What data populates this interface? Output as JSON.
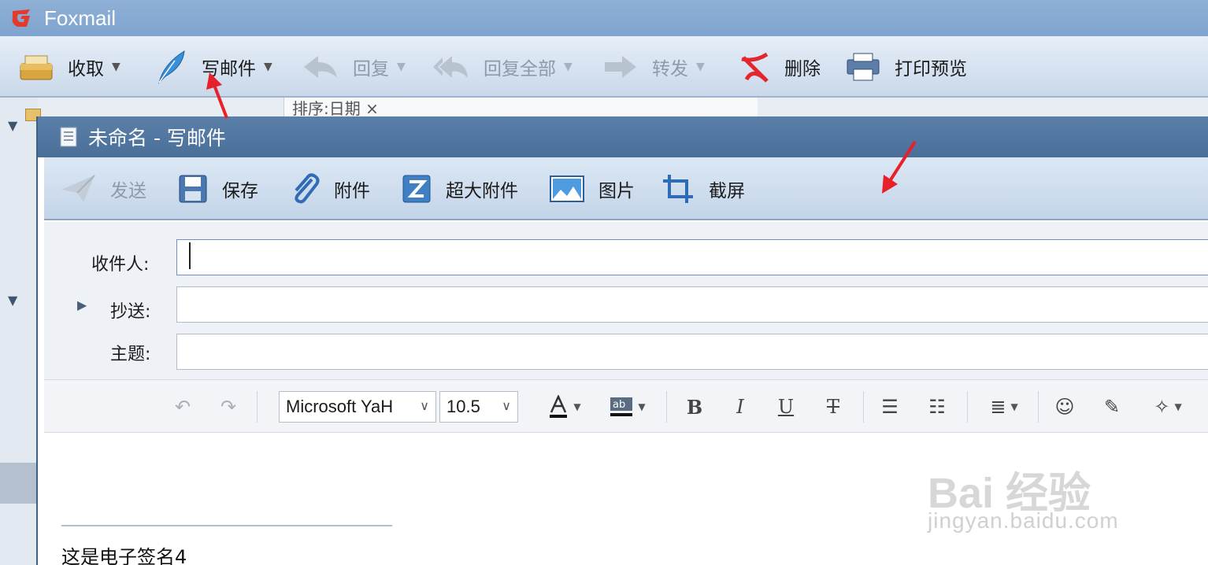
{
  "app": {
    "name": "Foxmail"
  },
  "main_toolbar": {
    "receive": "收取",
    "compose": "写邮件",
    "reply": "回复",
    "reply_all": "回复全部",
    "forward": "转发",
    "delete": "删除",
    "print_preview": "打印预览"
  },
  "list": {
    "sort_header": "排序:日期 ×"
  },
  "compose_window": {
    "title": "未命名 - 写邮件",
    "toolbar": {
      "send": "发送",
      "save": "保存",
      "attach": "附件",
      "big_attach": "超大附件",
      "image": "图片",
      "screenshot": "截屏"
    },
    "fields": {
      "to_label": "收件人:",
      "cc_label": "抄送:",
      "subject_label": "主题:"
    },
    "format": {
      "font": "Microsoft YaH",
      "size": "10.5"
    },
    "body": {
      "signature": "这是电子签名4"
    }
  },
  "watermark": {
    "brand": "Bai 经验",
    "url": "jingyan.baidu.com"
  },
  "colors": {
    "title_bar": "#7fa4cf",
    "compose_title": "#4a6f99",
    "annotation_arrow": "#e8202a"
  }
}
